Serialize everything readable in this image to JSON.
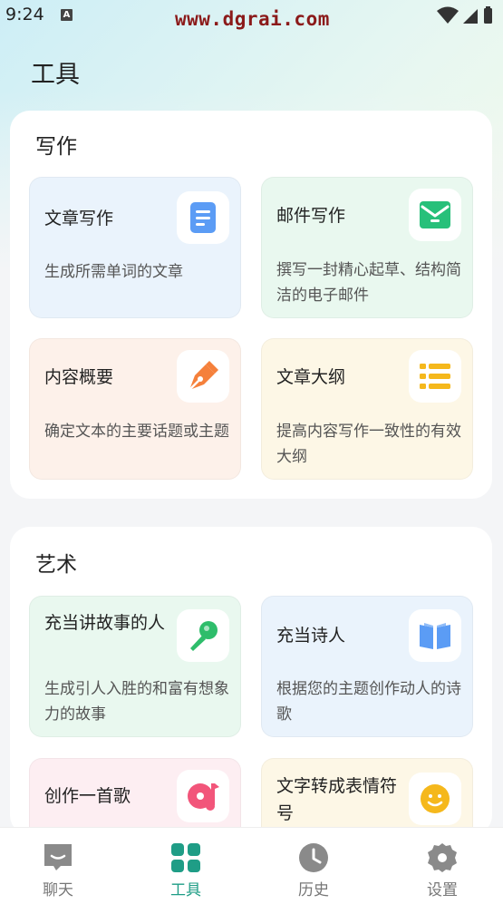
{
  "status_bar": {
    "time": "9:24",
    "notification_icon": "A",
    "watermark": "www.dgrai.com"
  },
  "page_title": "工具",
  "sections": [
    {
      "title": "写作",
      "cards": [
        {
          "title": "文章写作",
          "desc": "生成所需单词的文章",
          "icon": "document-icon",
          "color": "#5b9cf5"
        },
        {
          "title": "邮件写作",
          "desc": "撰写一封精心起草、结构简洁的电子邮件",
          "icon": "mail-icon",
          "color": "#27c07a"
        },
        {
          "title": "内容概要",
          "desc": "确定文本的主要话题或主题",
          "icon": "pen-icon",
          "color": "#f5803b"
        },
        {
          "title": "文章大纲",
          "desc": "提高内容写作一致性的有效大纲",
          "icon": "list-icon",
          "color": "#f5b81c"
        }
      ]
    },
    {
      "title": "艺术",
      "cards": [
        {
          "title": "充当讲故事的人",
          "desc": "生成引人入胜的和富有想象力的故事",
          "icon": "microphone-icon",
          "color": "#2ebd6b"
        },
        {
          "title": "充当诗人",
          "desc": "根据您的主题创作动人的诗歌",
          "icon": "book-icon",
          "color": "#5b9cf5"
        },
        {
          "title": "创作一首歌",
          "desc": "",
          "icon": "music-icon",
          "color": "#f2557a"
        },
        {
          "title": "文字转成表情符号",
          "desc": "",
          "icon": "smiley-icon",
          "color": "#f5b81c"
        }
      ]
    }
  ],
  "nav": [
    {
      "label": "聊天",
      "icon": "chat-icon"
    },
    {
      "label": "工具",
      "icon": "grid-icon",
      "active": true
    },
    {
      "label": "历史",
      "icon": "clock-icon"
    },
    {
      "label": "设置",
      "icon": "gear-icon"
    }
  ],
  "colors": {
    "accent": "#1f9d86",
    "nav_inactive": "#8a8a8a"
  }
}
